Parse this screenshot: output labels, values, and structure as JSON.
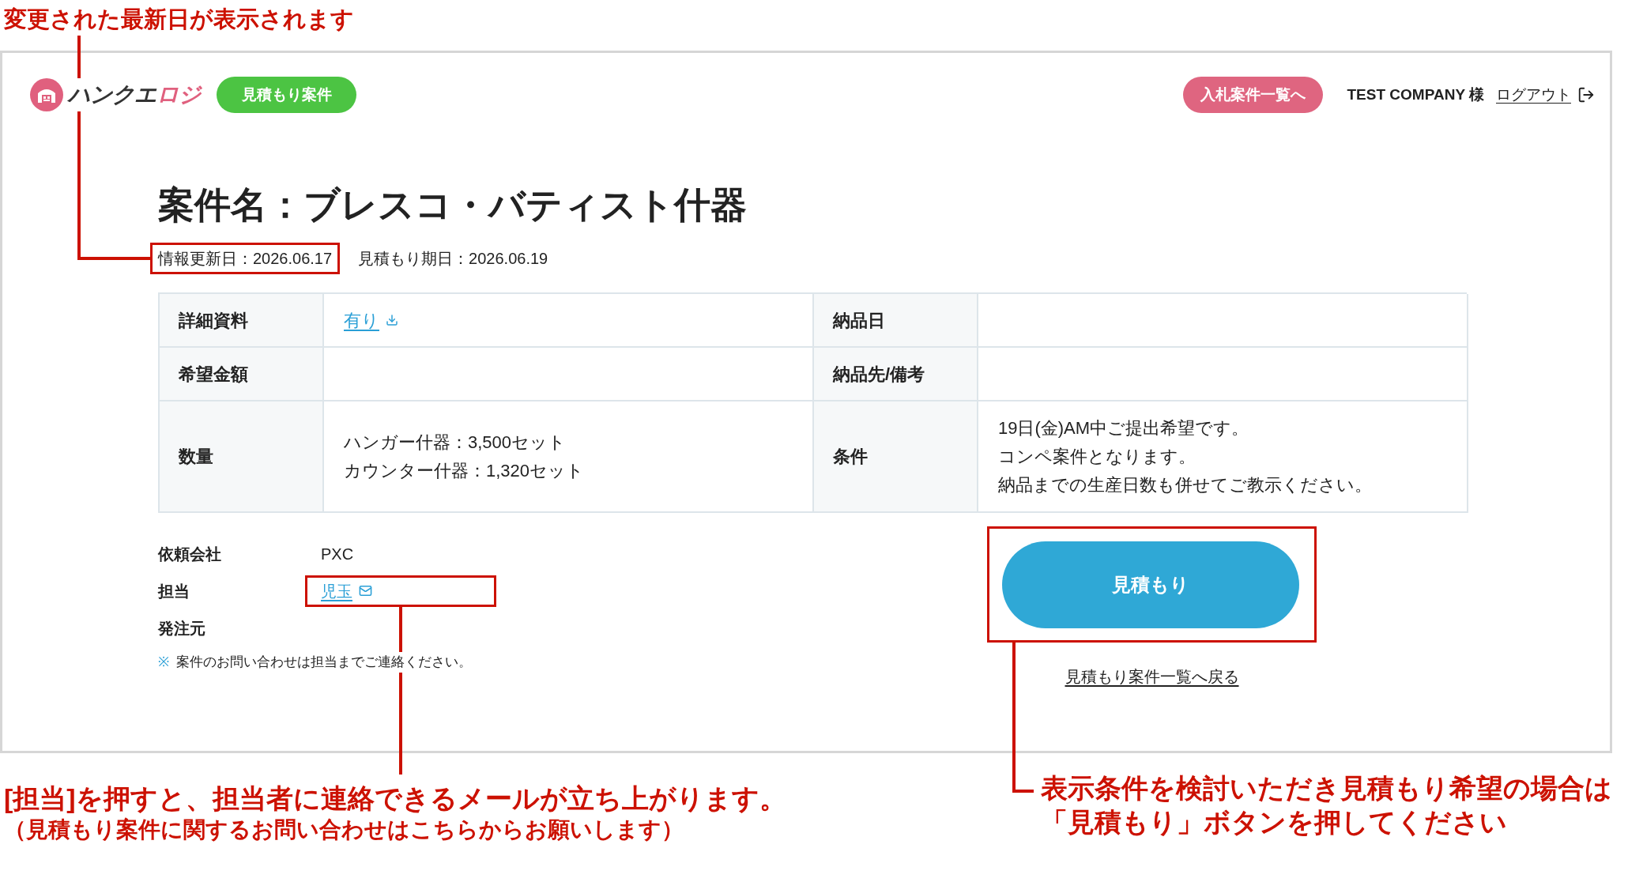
{
  "callout_top": {
    "text": "変更された最新日が表示されます"
  },
  "header": {
    "logo": {
      "parts": [
        {
          "text": "ハンクエ",
          "color": "#333333"
        },
        {
          "text": "ロジ",
          "color": "#e0607e"
        }
      ]
    },
    "nav_button": "見積もり案件",
    "list_button": "入札案件一覧へ",
    "user": "TEST COMPANY 様",
    "logout": "ログアウト"
  },
  "title": "案件名：ブレスコ・バティスト什器",
  "dates": [
    {
      "text": "情報更新日：2026.06.17",
      "highlighted": true
    },
    {
      "text": "見積もり期日：2026.06.19",
      "highlighted": false
    }
  ],
  "details_table": {
    "rows": [
      {
        "fields": [
          {
            "label": "詳細資料",
            "kind": "download_link",
            "value": "有り"
          },
          {
            "label": "納品日",
            "kind": "empty"
          }
        ]
      },
      {
        "fields": [
          {
            "label": "希望金額",
            "kind": "empty"
          },
          {
            "label": "納品先/備考",
            "kind": "empty"
          }
        ]
      },
      {
        "fields": [
          {
            "label": "数量",
            "kind": "lines",
            "lines": [
              "ハンガー什器：3,500セット",
              "カウンター什器：1,320セット"
            ]
          },
          {
            "label": "条件",
            "kind": "lines",
            "lines": [
              "19日(金)AM中ご提出希望です。",
              "コンペ案件となります。",
              "納品までの生産日数も併せてご教示ください。"
            ]
          }
        ]
      }
    ]
  },
  "client_info": [
    {
      "label": "依頼会社",
      "kind": "text",
      "value": "PXC",
      "highlighted": false
    },
    {
      "label": "担当",
      "kind": "mail_link",
      "value": "児玉",
      "highlighted": true
    },
    {
      "label": "発注元",
      "kind": "empty",
      "highlighted": false
    }
  ],
  "note": {
    "mark": "※",
    "text": "案件のお問い合わせは担当までご連絡ください。"
  },
  "estimate_button": {
    "label": "見積もり",
    "highlighted": true
  },
  "back_link": "見積もり案件一覧へ戻る",
  "callout_contact": {
    "lines": [
      "[担当]を押すと、担当者に連絡できるメールが立ち上がります。",
      "（見積もり案件に関するお問い合わせはこちらからお願いします）"
    ]
  },
  "callout_button": {
    "lines": [
      "表示条件を検討いただき見積もり希望の場合は",
      "「見積もり」ボタンを押してください"
    ]
  }
}
